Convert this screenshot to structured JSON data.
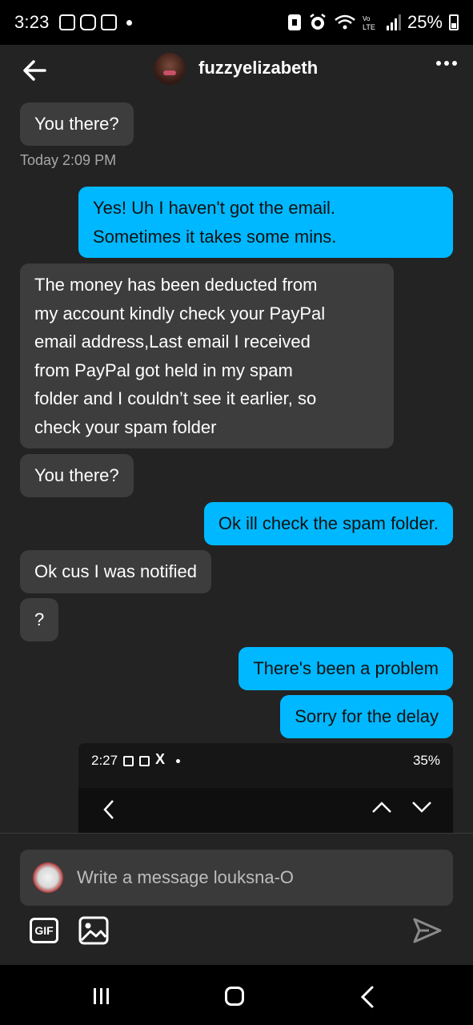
{
  "status_bar": {
    "time": "3:23",
    "battery": "25%"
  },
  "header": {
    "username": "fuzzyelizabeth"
  },
  "messages": [
    {
      "side": "in",
      "text": "You there?"
    },
    {
      "timestamp": "Today 2:09 PM"
    },
    {
      "side": "out",
      "lines": [
        "Yes!  Uh I haven't got the email.",
        "Sometimes it takes some mins."
      ]
    },
    {
      "side": "in",
      "lines": [
        "The money has been deducted from",
        "my account kindly check your PayPal",
        "email address,Last email I received",
        "from PayPal got held in my spam",
        "folder and I couldn’t see it earlier, so",
        "check your spam folder"
      ]
    },
    {
      "side": "in",
      "text": "You there?"
    },
    {
      "side": "out",
      "text": "Ok ill check the spam folder."
    },
    {
      "side": "in",
      "text": "Ok cus I was notified"
    },
    {
      "side": "in",
      "text": "?"
    },
    {
      "side": "out",
      "text": "There's been a problem"
    },
    {
      "side": "out",
      "text": "Sorry for the delay"
    }
  ],
  "screenshot_attachment": {
    "time": "2:27",
    "x_label": "X",
    "battery": "35%"
  },
  "composer": {
    "placeholder": "Write a message louksna-O",
    "gif_label": "GIF"
  },
  "colors": {
    "background": "#232323",
    "incoming_bubble": "#3d3d3d",
    "outgoing_bubble": "#00b8ff"
  }
}
